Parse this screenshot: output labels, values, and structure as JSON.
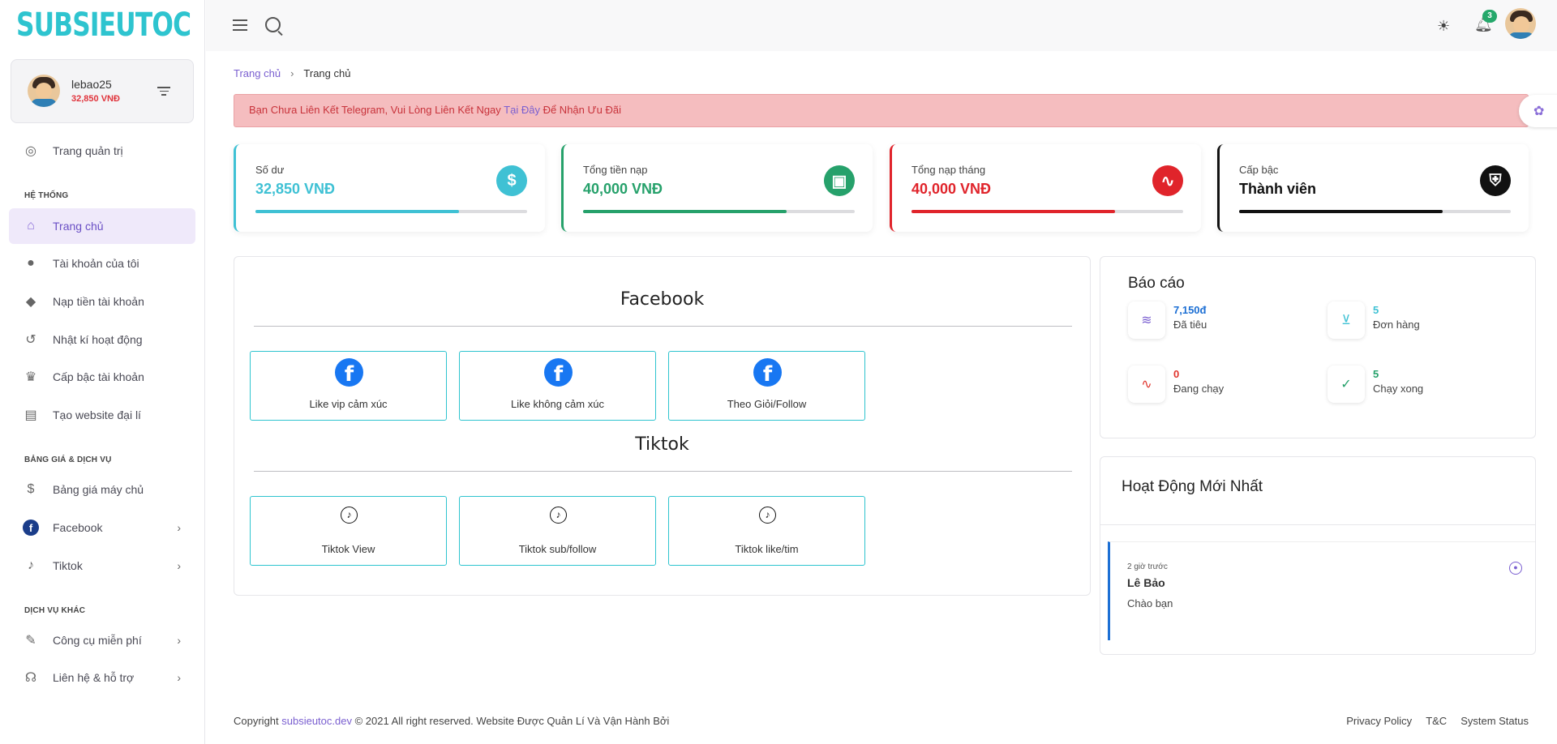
{
  "brand": {
    "logo": "SUBSIEUTOC",
    "color": "#2ec4cf"
  },
  "user": {
    "name": "lebao25",
    "balance": "32,850 VNĐ"
  },
  "sidebar": {
    "top_item": {
      "label": "Trang quản trị",
      "icon": "target-icon"
    },
    "sections": [
      {
        "title": "HỆ THỐNG"
      },
      {
        "title": "BẢNG GIÁ & DỊCH VỤ"
      },
      {
        "title": "DỊCH VỤ KHÁC"
      }
    ],
    "items": [
      {
        "label": "Trang chủ",
        "icon": "home-icon",
        "active": true
      },
      {
        "label": "Tài khoản của tôi",
        "icon": "user-icon"
      },
      {
        "label": "Nạp tiền tài khoản",
        "icon": "piggy-bank-icon"
      },
      {
        "label": "Nhật kí hoạt động",
        "icon": "history-icon"
      },
      {
        "label": "Cấp bậc tài khoản",
        "icon": "crown-icon"
      },
      {
        "label": "Tạo website đại lí",
        "icon": "presentation-icon"
      },
      {
        "label": "Bảng giá máy chủ",
        "icon": "dollar-circle-icon"
      },
      {
        "label": "Facebook",
        "icon": "facebook-icon",
        "chevron": true
      },
      {
        "label": "Tiktok",
        "icon": "tiktok-icon",
        "chevron": true
      },
      {
        "label": "Công cụ miễn phí",
        "icon": "brush-icon",
        "chevron": true
      },
      {
        "label": "Liên hệ & hỗ trợ",
        "icon": "headset-icon",
        "chevron": true
      }
    ]
  },
  "topbar": {
    "notification_count": "3"
  },
  "breadcrumb": {
    "home": "Trang chủ",
    "current": "Trang chủ"
  },
  "alert": {
    "text_before": "Bạn Chưa Liên Kết Telegram, Vui Lòng Liên Kết Ngay ",
    "link": "Tại Đây",
    "text_after": " Để Nhận Ưu Đãi"
  },
  "stats": [
    {
      "label": "Số dư",
      "value": "32,850 VNĐ",
      "color": "#3fc1d4",
      "icon": "dollar-icon",
      "progress": 0.75
    },
    {
      "label": "Tổng tiền nạp",
      "value": "40,000 VNĐ",
      "color": "#26a16b",
      "icon": "wallet-icon",
      "progress": 0.75
    },
    {
      "label": "Tổng nạp tháng",
      "value": "40,000 VNĐ",
      "color": "#e0242b",
      "icon": "pulse-icon",
      "progress": 0.75
    },
    {
      "label": "Cấp bậc",
      "value": "Thành viên",
      "color": "#111111",
      "icon": "shield-icon",
      "progress": 0.75
    }
  ],
  "services": {
    "facebook": {
      "title": "Facebook",
      "buttons": [
        "Like vip cảm xúc",
        "Like không cảm xúc",
        "Theo Giỏi/Follow"
      ]
    },
    "tiktok": {
      "title": "Tiktok",
      "buttons": [
        "Tiktok View",
        "Tiktok sub/follow",
        "Tiktok like/tim"
      ]
    }
  },
  "report": {
    "title": "Báo cáo",
    "items": [
      {
        "value": "7,150đ",
        "label": "Đã tiêu",
        "color": "#1c6fd4",
        "icon": "database-icon"
      },
      {
        "value": "5",
        "label": "Đơn hàng",
        "color": "#3fc1d4",
        "icon": "cart-icon"
      },
      {
        "value": "0",
        "label": "Đang chạy",
        "color": "#e0342c",
        "icon": "pulse-icon"
      },
      {
        "value": "5",
        "label": "Chạy xong",
        "color": "#26a16b",
        "icon": "check-icon"
      }
    ]
  },
  "activity": {
    "title": "Hoạt Động Mới Nhất",
    "item": {
      "time": "2 giờ trước",
      "name": "Lê Bảo",
      "message": "Chào bạn"
    }
  },
  "footer": {
    "copyright_before": "Copyright ",
    "site": "subsieutoc.dev",
    "copyright_after": " © 2021 All right reserved. Website Được Quản Lí Và Vận Hành Bởi",
    "links": [
      "Privacy Policy",
      "T&C",
      "System Status"
    ]
  }
}
